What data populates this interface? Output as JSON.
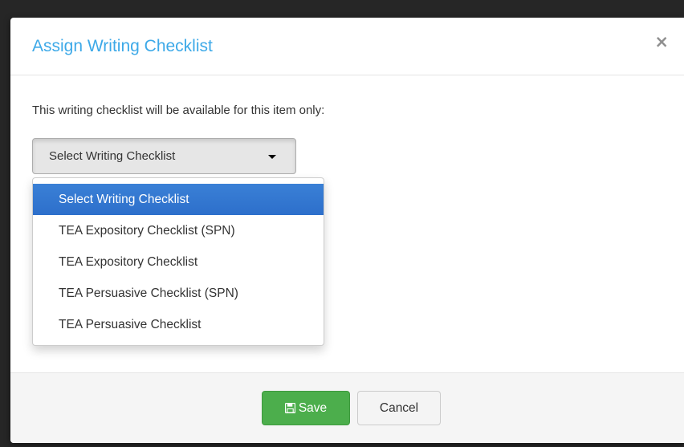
{
  "modal": {
    "title": "Assign Writing Checklist",
    "close_icon": "close-icon",
    "close_glyph": "×"
  },
  "body": {
    "info_text": "This writing checklist will be available for this item only:",
    "select": {
      "selected_label": "Select Writing Checklist",
      "icon": "caret-down-icon"
    },
    "options": [
      {
        "label": "Select Writing Checklist",
        "active": true
      },
      {
        "label": "TEA Expository Checklist (SPN)",
        "active": false
      },
      {
        "label": "TEA Expository Checklist",
        "active": false
      },
      {
        "label": "TEA Persuasive Checklist (SPN)",
        "active": false
      },
      {
        "label": "TEA Persuasive Checklist",
        "active": false
      }
    ]
  },
  "footer": {
    "save_label": "Save",
    "save_icon": "floppy-disk-icon",
    "cancel_label": "Cancel"
  },
  "colors": {
    "title": "#3da9e8",
    "active_option": "#3a80d6",
    "save_button": "#4cae4c"
  }
}
